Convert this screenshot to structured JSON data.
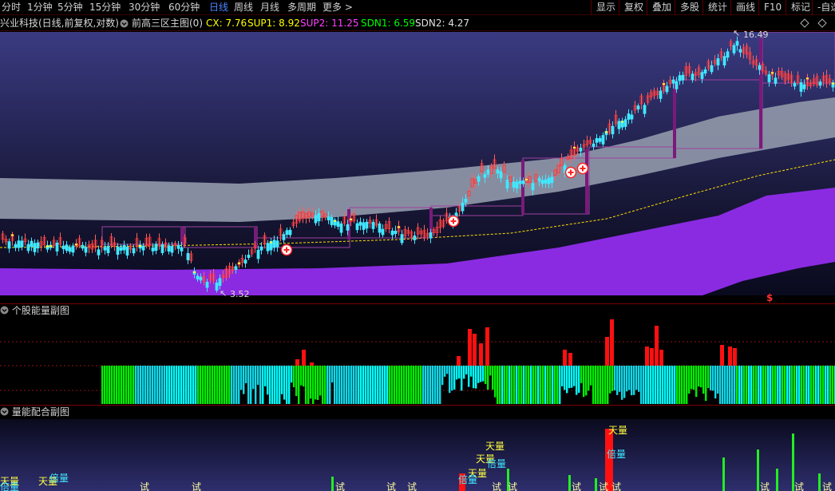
{
  "toolbar": {
    "periods": [
      "分时",
      "1分钟",
      "5分钟",
      "15分钟",
      "30分钟",
      "60分钟",
      "日线",
      "周线",
      "月线",
      "多周期",
      "更多 >"
    ],
    "active_period": "日线",
    "right_buttons": [
      "显示",
      "复权",
      "叠加",
      "多股",
      "统计",
      "画线",
      "F10",
      "标记",
      "-自选"
    ]
  },
  "info": {
    "stock": "兴业科技(日线,前复权,对数)",
    "indicator": "前高三区主图(0)",
    "cx": "CX: 7.76",
    "sup1": "SUP1: 8.92",
    "sup2": "SUP2: 11.25",
    "sdn1": "SDN1: 6.59",
    "sdn2": "SDN2: 4.27",
    "colors": {
      "cx": "#ffff00",
      "sup1": "#ffff00",
      "sup2": "#ff40ff",
      "sdn1": "#00ff00",
      "sdn2": "#e0e0e0"
    }
  },
  "main": {
    "high_label": "16.49",
    "low_label": "3.52",
    "dollar_marker": "$"
  },
  "panels": {
    "energy": {
      "title": "个股能量副图"
    },
    "volume": {
      "title": "量能配合副图"
    }
  },
  "volume_labels": {
    "tian": "天量",
    "bei": "倍量",
    "shi": "试"
  },
  "chart_data": {
    "type": "candlestick",
    "price_high": 16.49,
    "price_low": 3.52,
    "scale": "log"
  }
}
